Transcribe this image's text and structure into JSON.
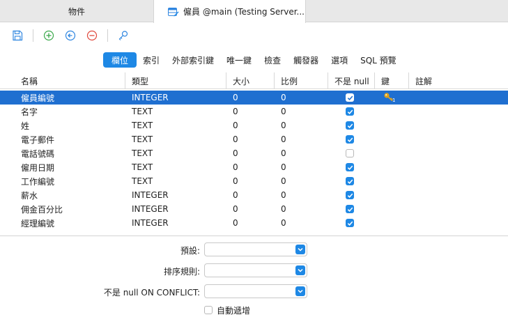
{
  "tabs": {
    "objects_label": "物件",
    "editor_label": "僱員 @main (Testing Server..."
  },
  "toolbar": {
    "icons": [
      "save-icon",
      "add-field-icon",
      "insert-field-icon",
      "delete-field-icon",
      "primary-key-icon"
    ]
  },
  "subtabs": [
    "欄位",
    "索引",
    "外部索引鍵",
    "唯一鍵",
    "檢查",
    "觸發器",
    "選項",
    "SQL 預覽"
  ],
  "columns": [
    "名稱",
    "類型",
    "大小",
    "比例",
    "不是 null",
    "鍵",
    "註解"
  ],
  "fields": [
    {
      "name": "僱員編號",
      "type": "INTEGER",
      "size": "0",
      "scale": "0",
      "not_null": true,
      "key": "1"
    },
    {
      "name": "名字",
      "type": "TEXT",
      "size": "0",
      "scale": "0",
      "not_null": true,
      "key": ""
    },
    {
      "name": "姓",
      "type": "TEXT",
      "size": "0",
      "scale": "0",
      "not_null": true,
      "key": ""
    },
    {
      "name": "電子郵件",
      "type": "TEXT",
      "size": "0",
      "scale": "0",
      "not_null": true,
      "key": ""
    },
    {
      "name": "電話號碼",
      "type": "TEXT",
      "size": "0",
      "scale": "0",
      "not_null": false,
      "key": ""
    },
    {
      "name": "僱用日期",
      "type": "TEXT",
      "size": "0",
      "scale": "0",
      "not_null": true,
      "key": ""
    },
    {
      "name": "工作編號",
      "type": "TEXT",
      "size": "0",
      "scale": "0",
      "not_null": true,
      "key": ""
    },
    {
      "name": "薪水",
      "type": "INTEGER",
      "size": "0",
      "scale": "0",
      "not_null": true,
      "key": ""
    },
    {
      "name": "佣金百分比",
      "type": "INTEGER",
      "size": "0",
      "scale": "0",
      "not_null": true,
      "key": ""
    },
    {
      "name": "經理編號",
      "type": "INTEGER",
      "size": "0",
      "scale": "0",
      "not_null": true,
      "key": ""
    }
  ],
  "selected_index": 0,
  "properties": {
    "default_label": "預設:",
    "collation_label": "排序規則:",
    "not_null_conflict_label": "不是 null ON CONFLICT:",
    "autoincrement_label": "自動遞增",
    "autoincrement_checked": false
  },
  "colors": {
    "accent": "#1e88e5",
    "selection": "#1f6fd0",
    "add_icon": "#3aa84a",
    "insert_icon": "#2f86e0",
    "delete_icon": "#e0483c",
    "key_icon": "#e0a21c"
  }
}
